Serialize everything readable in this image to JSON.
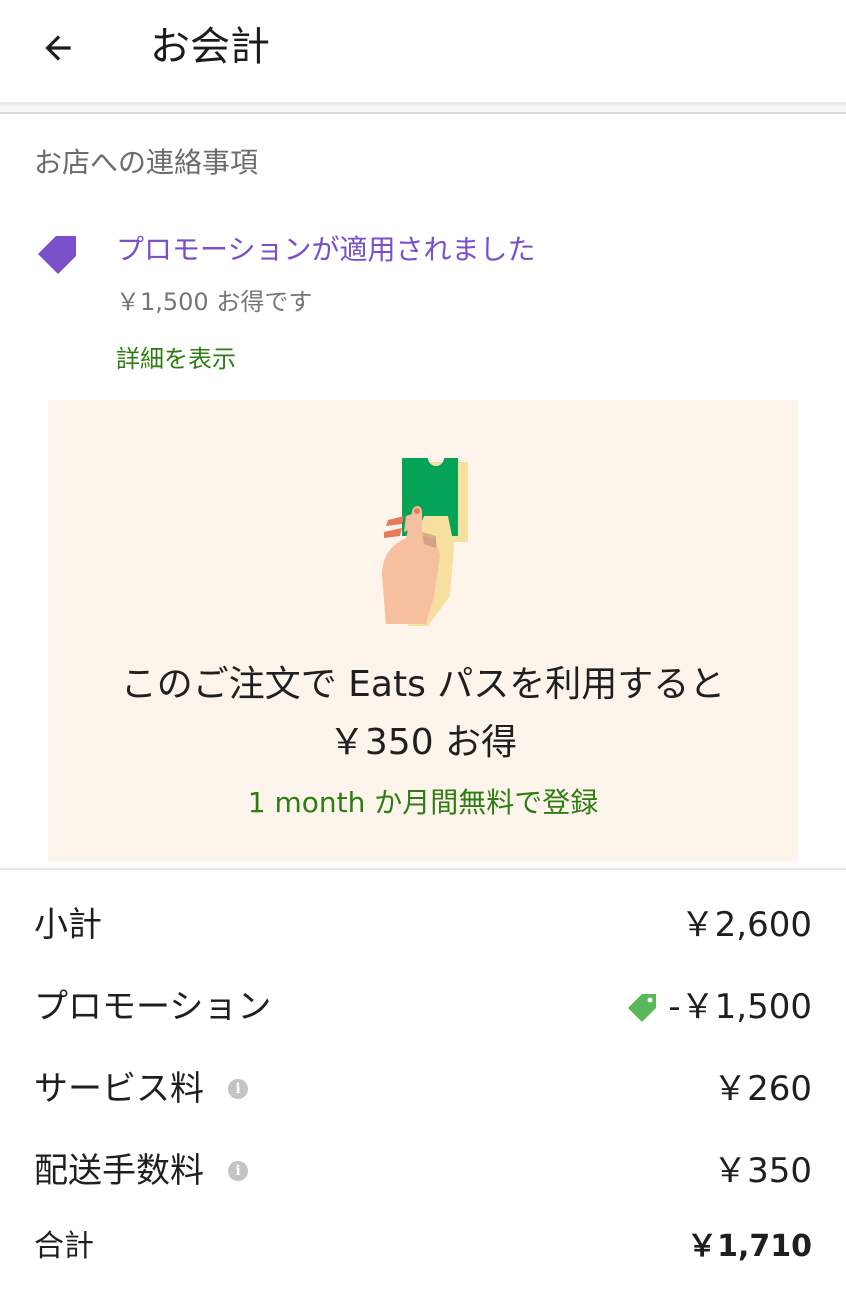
{
  "header": {
    "title": "お会計",
    "back_icon": "arrow-left-icon"
  },
  "store_note": {
    "label": "お店への連絡事項"
  },
  "promotion": {
    "icon": "tag-icon",
    "icon_color": "#7b4fc9",
    "title": "プロモーションが適用されました",
    "subtitle": "￥1,500 お得です",
    "details_link": "詳細を表示"
  },
  "eats_pass": {
    "line1": "このご注文で Eats パスを利用すると",
    "line2": "￥350 お得",
    "cta": "1 month か月間無料で登録",
    "background": "#fdf5eb",
    "accent": "#2e7d12"
  },
  "summary": {
    "subtotal": {
      "label": "小計",
      "value": "￥2,600"
    },
    "promotion": {
      "label": "プロモーション",
      "value": "-￥1,500",
      "icon": "tag-icon",
      "icon_color": "#5cb85c"
    },
    "service_fee": {
      "label": "サービス料",
      "value": "￥260",
      "info_icon": "info-icon"
    },
    "delivery_fee": {
      "label": "配送手数料",
      "value": "￥350",
      "info_icon": "info-icon"
    },
    "total": {
      "label": "合計",
      "value": "￥1,710"
    }
  }
}
